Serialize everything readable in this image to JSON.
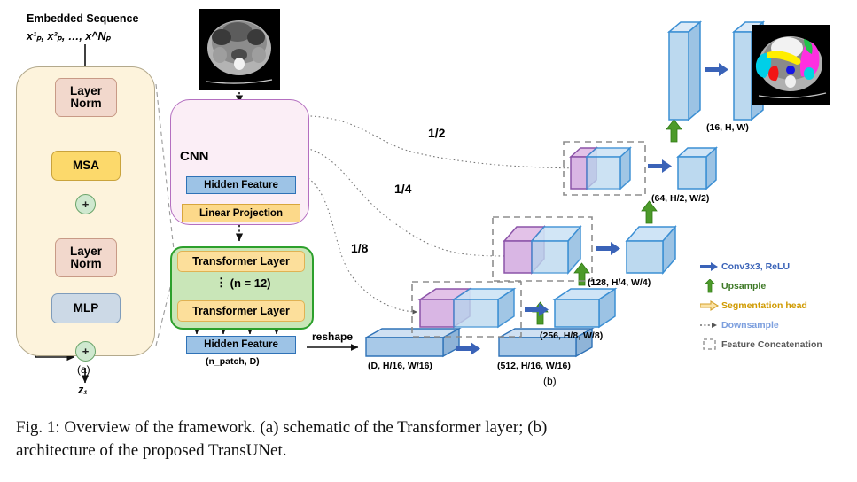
{
  "figure": {
    "panel_a_label": "(a)",
    "panel_b_label": "(b)",
    "embedded_title": "Embedded Sequence",
    "embedded_seq": "x¹ₚ, x²ₚ, …, x^Nₚ",
    "output_symbol": "z₁"
  },
  "transformer_layer": {
    "layer_norm_1": "Layer Norm",
    "msa": "MSA",
    "layer_norm_2": "Layer Norm",
    "mlp": "MLP",
    "add_symbol": "+"
  },
  "cnn": {
    "title": "CNN",
    "hidden_feature": "Hidden Feature",
    "linear_projection": "Linear Projection"
  },
  "encoder": {
    "transformer_layer_top": "Transformer Layer",
    "transformer_layer_bottom": "Transformer Layer",
    "repeat_note": "(n = 12)",
    "hidden_feature": "Hidden Feature",
    "hidden_feature_shape": "(n_patch, D)",
    "reshape_label": "reshape"
  },
  "skip_labels": [
    "1/2",
    "1/4",
    "1/8"
  ],
  "decoder_shapes": [
    "(D, H/16, W/16)",
    "(512, H/16, W/16)",
    "(256, H/8, W/8)",
    "(128, H/4, W/4)",
    "(64, H/2, W/2)",
    "(16, H, W)"
  ],
  "legend": {
    "items": [
      {
        "icon": "solid-arrow-right-icon",
        "label": "Conv3x3, ReLU",
        "color": "#3a63b8"
      },
      {
        "icon": "solid-arrow-up-icon",
        "label": "Upsample",
        "color": "#3f8f29"
      },
      {
        "icon": "hollow-arrow-right-icon",
        "label": "Segmentation head",
        "color": "#d09a00"
      },
      {
        "icon": "dotted-arrow-right-icon",
        "label": "Downsample",
        "color": "#7b9ede"
      },
      {
        "icon": "dashed-box-icon",
        "label": "Feature Concatenation",
        "color": "#808080"
      }
    ]
  },
  "caption": {
    "line1": "Fig. 1: Overview of the framework. (a) schematic of the Transformer layer; (b)",
    "line2": "architecture of the proposed TransUNet."
  },
  "colors": {
    "panel_a_bg": "#fdf3dc",
    "cnn_bg": "#fbeef6",
    "transformer_bg": "#c9e6b8",
    "layer_norm": "#f2d8cc",
    "msa": "#fcd96b",
    "mlp": "#ccd9e6",
    "hidden_feature": "#9dc3e6",
    "linear_projection": "#fcd98a",
    "feature_blue": "#bcd9ef",
    "feature_purple": "#e3c2e8",
    "conv_arrow": "#3a63b8",
    "upsample_arrow": "#3f8f29",
    "seg_head_arrow": "#e8b84b"
  }
}
